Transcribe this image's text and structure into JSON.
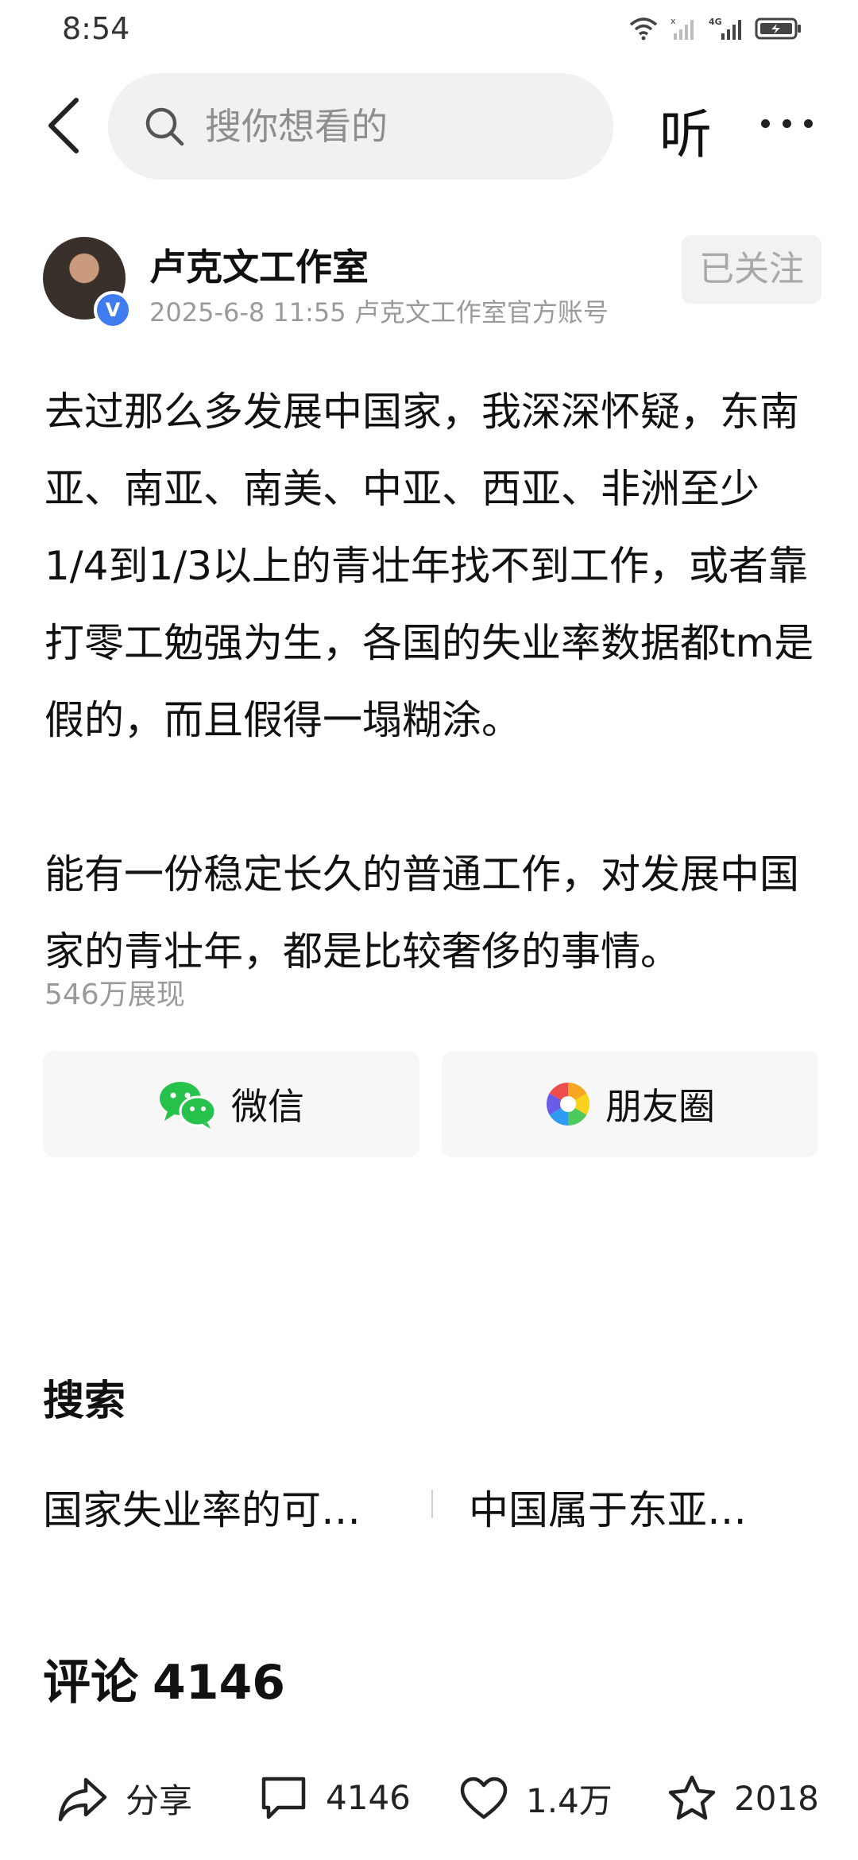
{
  "status_bar": {
    "time": "8:54",
    "network": "4G",
    "icons": [
      "wifi-icon",
      "signal-icon",
      "signal-4g-icon",
      "battery-charging-icon"
    ]
  },
  "top_bar": {
    "search_placeholder": "搜你想看的",
    "listen_label": "听",
    "icons": [
      "back-icon",
      "search-icon",
      "more-icon"
    ]
  },
  "post": {
    "author": {
      "name": "卢克文工作室",
      "badge": "V",
      "meta": "2025-6-8 11:55 卢克文工作室官方账号"
    },
    "follow_label": "已关注",
    "paragraphs": [
      "去过那么多发展中国家，我深深怀疑，东南亚、南亚、南美、中亚、西亚、非洲至少1/4到1/3以上的青壮年找不到工作，或者靠打零工勉强为生，各国的失业率数据都tm是假的，而且假得一塌糊涂。",
      "能有一份稳定长久的普通工作，对发展中国家的青壮年，都是比较奢侈的事情。"
    ],
    "views": "546万展现"
  },
  "share": {
    "wechat_label": "微信",
    "moments_label": "朋友圈"
  },
  "search_section": {
    "title": "搜索",
    "suggestions": [
      "国家失业率的可…",
      "中国属于东亚…"
    ]
  },
  "comments": {
    "label": "评论",
    "count": "4146"
  },
  "bottom_bar": {
    "share_label": "分享",
    "comment_count": "4146",
    "like_count": "1.4万",
    "favorite_count": "2018"
  },
  "colors": {
    "wechat_green": "#27c24c",
    "verified_blue": "#3f7cf0",
    "muted_text": "#9a9a9a",
    "search_bg": "#f1f1f1"
  }
}
